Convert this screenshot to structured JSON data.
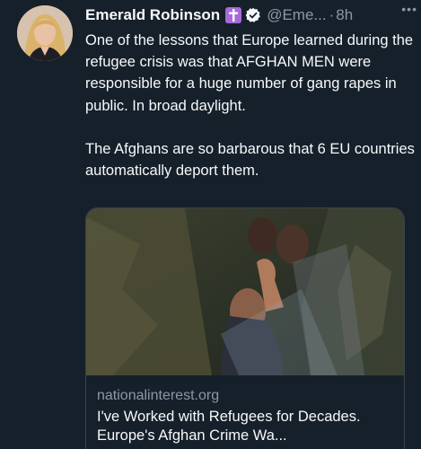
{
  "author": {
    "name": "Emerald Robinson",
    "handle": "@Eme...",
    "separator": "·",
    "time": "8h",
    "badge_icon": "cross-badge-icon",
    "verified_icon": "verified-badge-icon"
  },
  "more_label": "•••",
  "tweet": {
    "paragraph1": "One of the lessons that Europe learned during the refugee crisis was that AFGHAN MEN were responsible for a huge number of gang rapes in public. In broad daylight.",
    "paragraph2": "The Afghans are so barbarous that 6 EU countries automatically deport them."
  },
  "link_card": {
    "domain": "nationalinterest.org",
    "title": "I've Worked with Refugees for Decades. Europe's Afghan Crime Wa..."
  },
  "colors": {
    "background": "#15202b",
    "text": "#f7f9f9",
    "muted": "#8b98a5",
    "verified": "#f7f9f9",
    "badge": "#a66bd9",
    "card_border": "#38444d"
  }
}
